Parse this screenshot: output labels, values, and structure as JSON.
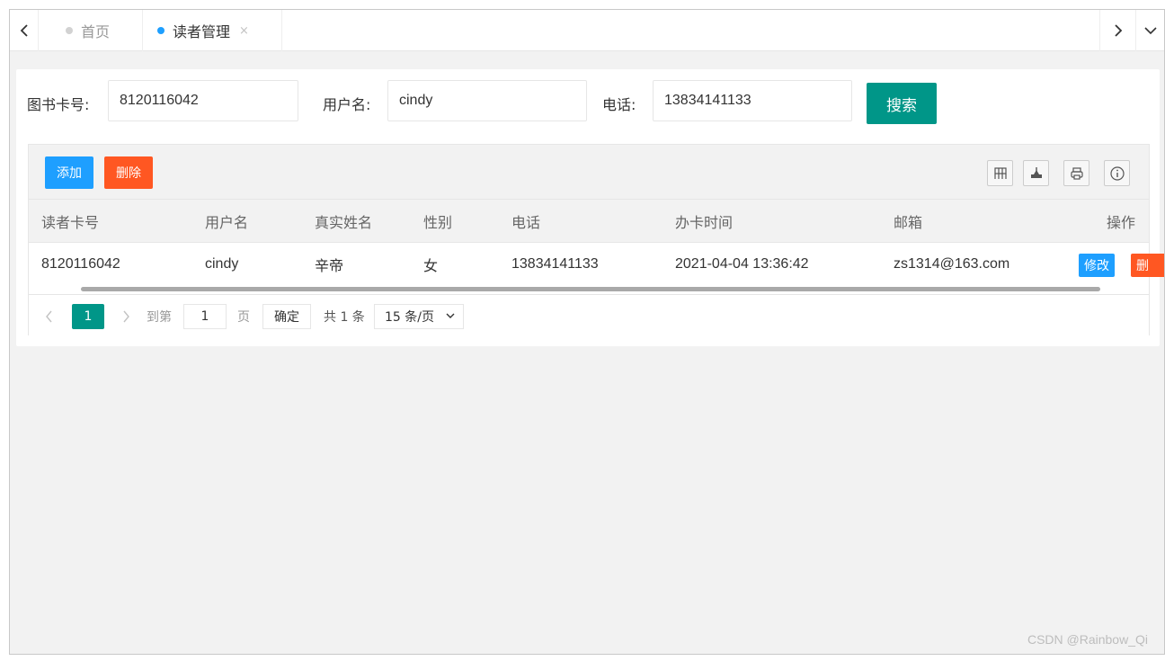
{
  "tabs": {
    "home": "首页",
    "reader": "读者管理",
    "close": "×"
  },
  "search": {
    "card_label": "图书卡号:",
    "card_value": "8120116042",
    "username_label": "用户名:",
    "username_value": "cindy",
    "phone_label": "电话:",
    "phone_value": "13834141133",
    "button": "搜索"
  },
  "toolbar": {
    "add": "添加",
    "delete": "删除",
    "icons": [
      "columns-icon",
      "export-icon",
      "print-icon",
      "info-icon"
    ]
  },
  "table": {
    "columns": [
      "读者卡号",
      "用户名",
      "真实姓名",
      "性别",
      "电话",
      "办卡时间",
      "邮箱",
      "操作"
    ],
    "rows": [
      {
        "card": "8120116042",
        "username": "cindy",
        "realname": "辛帝",
        "gender": "女",
        "phone": "13834141133",
        "created": "2021-04-04 13:36:42",
        "email": "zs1314@163.com",
        "edit": "修改",
        "delete": "删"
      }
    ]
  },
  "pager": {
    "current": "1",
    "goto_prefix": "到第",
    "goto_value": "1",
    "goto_unit": "页",
    "confirm": "确定",
    "total": "共 1 条",
    "page_size": "15 条/页"
  },
  "watermark": "CSDN @Rainbow_Qi",
  "colors": {
    "primary": "#009688",
    "blue": "#1e9fff",
    "orange": "#ff5722"
  }
}
